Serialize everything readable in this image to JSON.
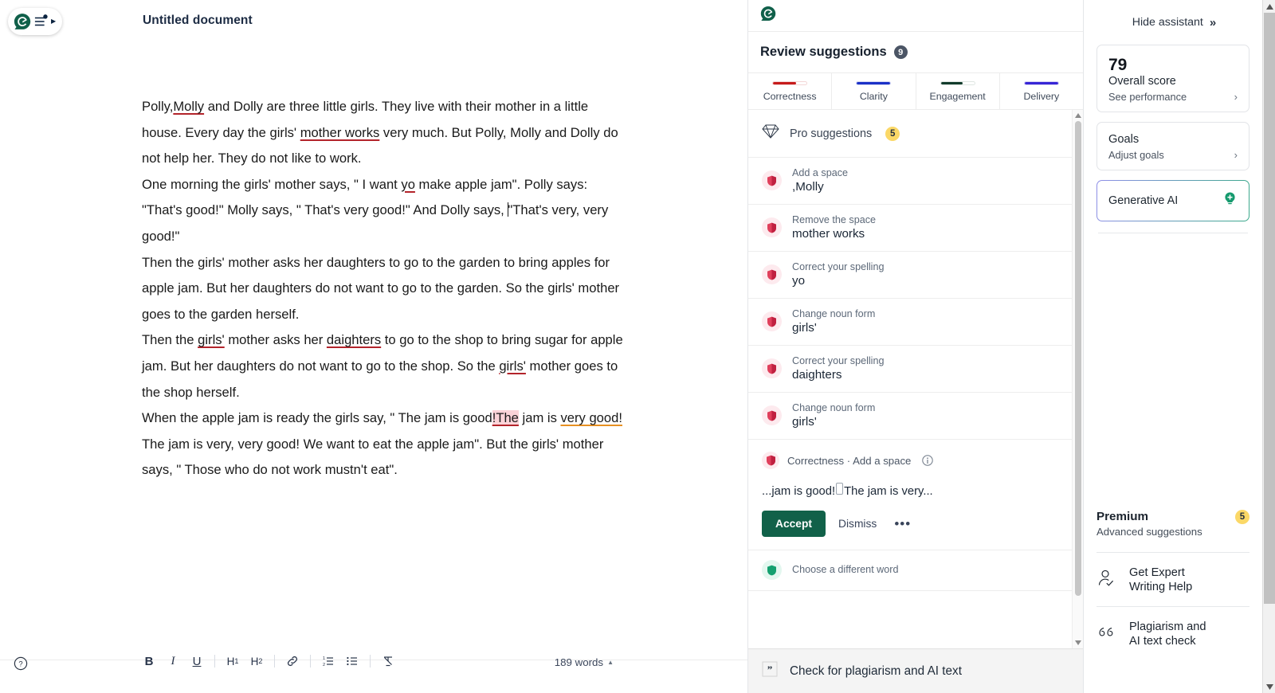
{
  "editor": {
    "doc_title": "Untitled document",
    "logo_icon": "grammarly-g-icon",
    "sliders_icon": "sliders-icon",
    "paragraphs": [
      {
        "id": "p1",
        "runs": [
          {
            "t": "Polly,",
            "s": "plain"
          },
          {
            "t": "Molly",
            "s": "u-red"
          },
          {
            "t": " and Dolly are three little girls. They live with their mother in a little house. Every day the girls' ",
            "s": "plain"
          },
          {
            "t": "mother  works",
            "s": "u-red"
          },
          {
            "t": " very much. But Polly, Molly and Dolly do not help her. They do not like to work.",
            "s": "plain"
          }
        ]
      },
      {
        "id": "p2",
        "runs": [
          {
            "t": " One morning the girls' mother says, \" I want ",
            "s": "plain"
          },
          {
            "t": "yo",
            "s": "u-red"
          },
          {
            "t": " make apple jam\". Polly says: \"That's good!\" Molly says, \" That's very good!\" And Dolly says, ",
            "s": "plain"
          },
          {
            "t": "CARET",
            "s": "caret"
          },
          {
            "t": "\"That's very, very good!\"",
            "s": "plain"
          }
        ]
      },
      {
        "id": "p3",
        "runs": [
          {
            "t": " Then the girls' mother asks her daughters to go to the garden to bring apples for apple jam. But her daughters do not want to go to the garden. So the girls' mother goes to the garden herself.",
            "s": "plain"
          }
        ]
      },
      {
        "id": "p4",
        "runs": [
          {
            "t": " Then the ",
            "s": "plain"
          },
          {
            "t": "girls'",
            "s": "u-red"
          },
          {
            "t": " mother asks her ",
            "s": "plain"
          },
          {
            "t": "daighters",
            "s": "u-red"
          },
          {
            "t": " to go to the shop to bring sugar for apple jam. But her daughters do not want to go to the shop. So the ",
            "s": "plain"
          },
          {
            "t": "girls'",
            "s": "u-red"
          },
          {
            "t": " mother goes to the shop herself.",
            "s": "plain"
          }
        ]
      },
      {
        "id": "p5",
        "runs": [
          {
            "t": " When the apple jam is ready the girls say, \" The jam is good",
            "s": "plain"
          },
          {
            "t": "!The",
            "s": "hl-red"
          },
          {
            "t": " jam is ",
            "s": "plain"
          },
          {
            "t": "very good!",
            "s": "u-orange"
          },
          {
            "t": " The jam is very, very good! We want to eat the apple jam\". But the girls' mother says, \" Those who do not work mustn't eat\".",
            "s": "plain"
          }
        ]
      }
    ],
    "toolbar": {
      "help_icon": "help-circle-icon",
      "bold": "B",
      "italic": "I",
      "underline": "U",
      "h1": "H",
      "h1_sub": "1",
      "h2": "H",
      "h2_sub": "2",
      "link_icon": "link-icon",
      "ordered_list_icon": "ordered-list-icon",
      "bullet_list_icon": "bullet-list-icon",
      "clear_format_icon": "clear-formatting-icon",
      "word_count": "189 words",
      "word_count_caret": "▲"
    }
  },
  "suggestions_panel": {
    "logo_icon": "grammarly-g-icon",
    "title": "Review suggestions",
    "count_badge": "9",
    "categories": [
      {
        "label": "Correctness",
        "color": "#c61a1a",
        "fill_pct": 68,
        "track": "#f3d6d6"
      },
      {
        "label": "Clarity",
        "color": "#1b31c7",
        "fill_pct": 100,
        "track": "#d3d7f3"
      },
      {
        "label": "Engagement",
        "color": "#123b2b",
        "fill_pct": 66,
        "track": "#dfe6e2"
      },
      {
        "label": "Delivery",
        "color": "#3725d6",
        "fill_pct": 100,
        "track": "#d7d3f3"
      }
    ],
    "pro_row": {
      "icon": "diamond-icon",
      "label": "Pro suggestions",
      "badge": "5"
    },
    "items": [
      {
        "icon": "correctness-shield-icon",
        "tone": "red",
        "kind": "Add a space",
        "word": ",Molly"
      },
      {
        "icon": "correctness-shield-icon",
        "tone": "red",
        "kind": "Remove the space",
        "word": "mother  works"
      },
      {
        "icon": "correctness-shield-icon",
        "tone": "red",
        "kind": "Correct your spelling",
        "word": "yo"
      },
      {
        "icon": "correctness-shield-icon",
        "tone": "red",
        "kind": "Change noun form",
        "word": "girls'"
      },
      {
        "icon": "correctness-shield-icon",
        "tone": "red",
        "kind": "Correct your spelling",
        "word": "daighters"
      },
      {
        "icon": "correctness-shield-icon",
        "tone": "red",
        "kind": "Change noun form",
        "word": "girls'"
      }
    ],
    "expanded_card": {
      "icon": "correctness-shield-icon",
      "category_line": "Correctness · Add a space",
      "info_icon": "info-icon",
      "preview_before": "...jam is good!",
      "preview_after": "The jam is very...",
      "accept_label": "Accept",
      "dismiss_label": "Dismiss",
      "more_label": "•••"
    },
    "trailing_item": {
      "icon": "engagement-icon",
      "tone": "green",
      "kind": "Choose a different word"
    },
    "plagiarism_bar": {
      "icon": "quote-icon",
      "label": "Check for plagiarism and AI text"
    }
  },
  "sidebar": {
    "hide_assistant": {
      "label": "Hide assistant",
      "icon": "chevron-double-right-icon"
    },
    "score_card": {
      "score": "79",
      "label": "Overall score",
      "link": "See performance",
      "chevron": "›"
    },
    "goals_card": {
      "title": "Goals",
      "link": "Adjust goals",
      "chevron": "›"
    },
    "generative_ai": {
      "label": "Generative AI",
      "icon": "lightbulb-plus-icon"
    },
    "premium": {
      "title": "Premium",
      "subtitle": "Advanced suggestions",
      "badge": "5"
    },
    "links": [
      {
        "icon": "expert-person-icon",
        "label_line1": "Get Expert",
        "label_line2": "Writing Help"
      },
      {
        "icon": "quote-marks-icon",
        "label_line1": "Plagiarism and",
        "label_line2": "AI text check"
      }
    ]
  }
}
